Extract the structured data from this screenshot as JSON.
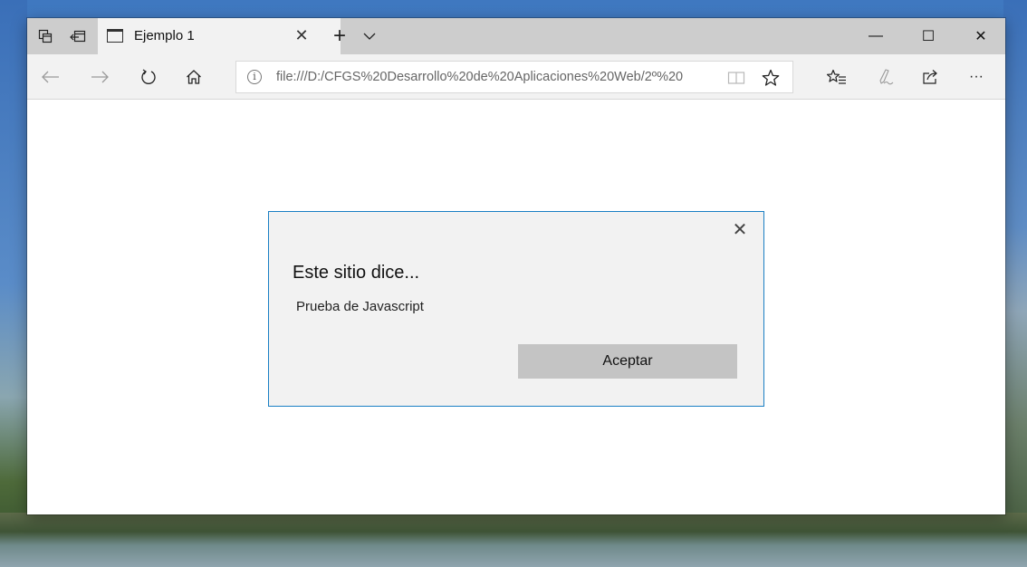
{
  "browser": {
    "tab": {
      "title": "Ejemplo 1"
    },
    "address": {
      "url": "file:///D:/CFGS%20Desarrollo%20de%20Aplicaciones%20Web/2º%20"
    },
    "window_controls": {
      "minimize": "—",
      "maximize": "☐",
      "close": "✕"
    },
    "icons": {
      "tab_actions": "tab-actions-icon",
      "set_aside": "set-aside-tabs-icon",
      "tab_page": "page-icon",
      "tab_close": "close-icon",
      "new_tab": "plus-icon",
      "tab_menu": "chevron-down-icon",
      "back": "arrow-left-icon",
      "forward": "arrow-right-icon",
      "refresh": "refresh-icon",
      "home": "home-icon",
      "info": "info-icon",
      "reading_view": "book-icon",
      "favorite": "star-icon",
      "favorites_hub": "favorites-list-icon",
      "web_note": "pen-icon",
      "share": "share-icon",
      "more": "more-icon"
    },
    "accent_color": "#1a7fc4"
  },
  "dialog": {
    "title": "Este sitio dice...",
    "message": "Prueba de Javascript",
    "ok_label": "Aceptar",
    "close_glyph": "✕"
  }
}
